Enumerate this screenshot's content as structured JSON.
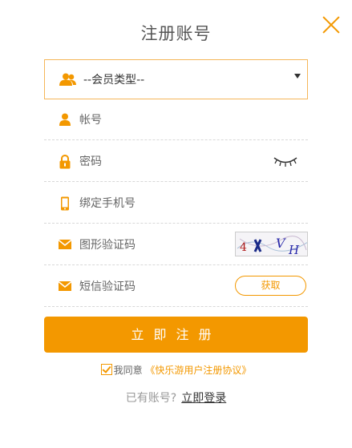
{
  "header": {
    "title": "注册账号"
  },
  "colors": {
    "accent": "#f39800",
    "divider": "#d8d8d8"
  },
  "form": {
    "member_type": {
      "selected": "--会员类型--",
      "icon": "users-icon"
    },
    "account": {
      "placeholder": "帐号",
      "icon": "user-icon"
    },
    "password": {
      "placeholder": "密码",
      "icon": "lock-icon",
      "toggle_icon": "eye-closed-icon"
    },
    "phone": {
      "placeholder": "绑定手机号",
      "icon": "phone-icon"
    },
    "captcha": {
      "placeholder": "图形验证码",
      "icon": "envelope-icon",
      "image_text": "4 X VH"
    },
    "sms_code": {
      "placeholder": "短信验证码",
      "icon": "envelope-icon",
      "get_label": "获取"
    }
  },
  "actions": {
    "register_label": "立即注册"
  },
  "agreement": {
    "prefix": "我同意",
    "link": "《快乐游用户注册协议》"
  },
  "login": {
    "prompt": "已有账号?",
    "link": "立即登录"
  }
}
